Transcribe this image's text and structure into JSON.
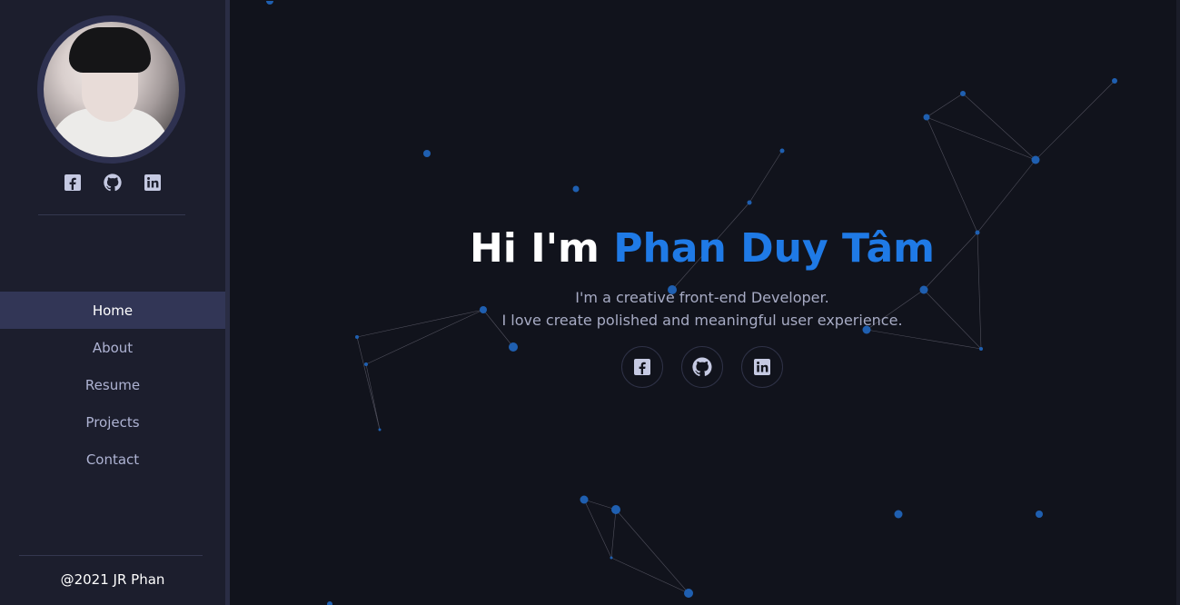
{
  "sidebar": {
    "avatar_alt": "Phan Duy Tâm avatar",
    "social": [
      "facebook-icon",
      "github-icon",
      "linkedin-icon"
    ],
    "nav": [
      {
        "label": "Home",
        "active": true
      },
      {
        "label": "About",
        "active": false
      },
      {
        "label": "Resume",
        "active": false
      },
      {
        "label": "Projects",
        "active": false
      },
      {
        "label": "Contact",
        "active": false
      }
    ],
    "footer": "@2021 JR Phan"
  },
  "hero": {
    "greeting": "Hi I'm ",
    "name": "Phan Duy Tâm",
    "line1": "I'm a creative front-end Developer.",
    "line2": "I love create polished and meaningful user experience.",
    "social": [
      "facebook-icon",
      "github-icon",
      "linkedin-icon"
    ]
  },
  "colors": {
    "accent": "#1f7ae6",
    "sidebar_bg": "#1c1e2d",
    "main_bg": "#11131c",
    "active_nav": "#323656"
  }
}
